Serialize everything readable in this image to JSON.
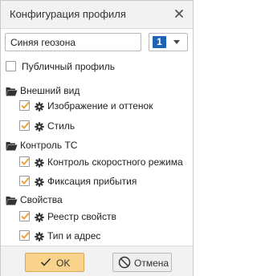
{
  "dialog": {
    "title": "Конфигурация профиля"
  },
  "profile": {
    "name_value": "Синяя геозона",
    "number_value": "1"
  },
  "public_profile": {
    "label": "Публичный профиль",
    "checked": false
  },
  "groups": [
    {
      "label": "Внешний вид",
      "items": [
        {
          "label": "Изображение и оттенок",
          "checked": true
        },
        {
          "label": "Стиль",
          "checked": true
        }
      ]
    },
    {
      "label": "Контроль ТС",
      "items": [
        {
          "label": "Контроль скоростного режима",
          "checked": true
        },
        {
          "label": "Фиксация прибытия",
          "checked": true
        }
      ]
    },
    {
      "label": "Свойства",
      "items": [
        {
          "label": "Реестр свойств",
          "checked": true
        },
        {
          "label": "Тип и адрес",
          "checked": true
        }
      ]
    }
  ],
  "buttons": {
    "ok_label": "OK",
    "cancel_label": "Отмена"
  },
  "colors": {
    "check_mark": "#e8a33c",
    "ok_button": "#f9d28b",
    "number_badge": "#1f63b8"
  }
}
